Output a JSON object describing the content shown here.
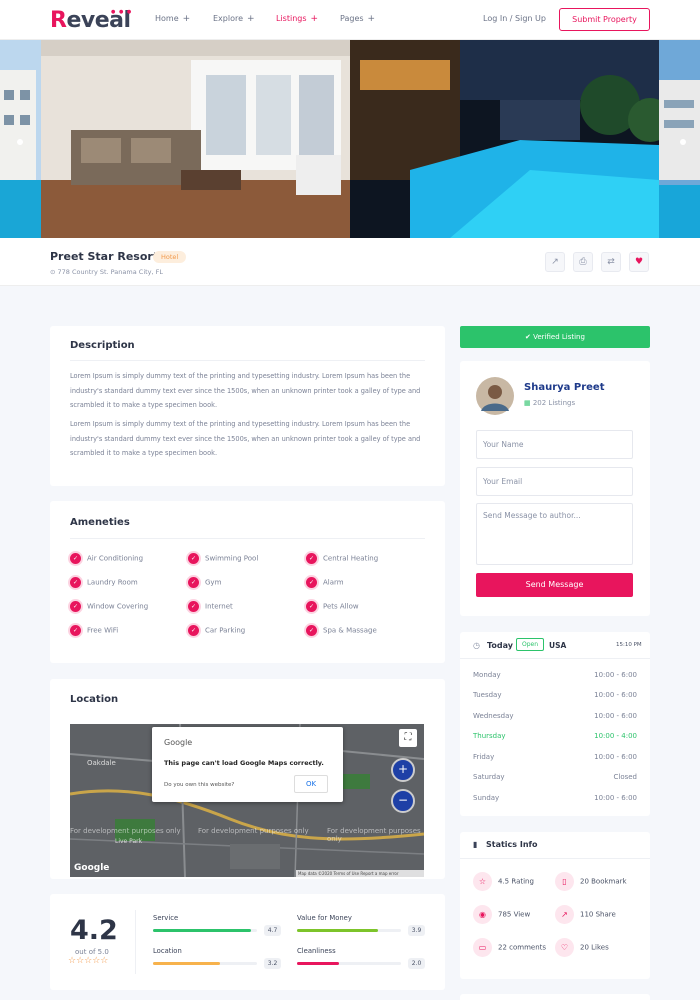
{
  "header": {
    "logo": "Reveal",
    "nav": [
      {
        "label": "Home",
        "plus": "+"
      },
      {
        "label": "Explore",
        "plus": "+"
      },
      {
        "label": "Listings",
        "plus": "+"
      },
      {
        "label": "Pages",
        "plus": "+"
      }
    ],
    "login": "Log In  /  Sign Up",
    "submit": "Submit Property"
  },
  "listing": {
    "title": "Preet Star Resort",
    "badge": "Hotel",
    "address": "778 Country St. Panama City, FL"
  },
  "description": {
    "title": "Description",
    "paragraphs": [
      "Lorem Ipsum is simply dummy text of the printing and typesetting industry. Lorem Ipsum has been the industry's standard dummy text ever since the 1500s, when an unknown printer took a galley of type and scrambled it to make a type specimen book.",
      "Lorem Ipsum is simply dummy text of the printing and typesetting industry. Lorem Ipsum has been the industry's standard dummy text ever since the 1500s, when an unknown printer took a galley of type and scrambled it to make a type specimen book."
    ]
  },
  "amenities": {
    "title": "Ameneties",
    "items": [
      "Air Conditioning",
      "Swimming Pool",
      "Central Heating",
      "Laundry Room",
      "Gym",
      "Alarm",
      "Window Covering",
      "Internet",
      "Pets Allow",
      "Free WiFi",
      "Car Parking",
      "Spa & Massage"
    ]
  },
  "location": {
    "title": "Location",
    "map": {
      "google": "Google",
      "error": "This page can't load Google Maps correctly.",
      "own": "Do you own this website?",
      "ok": "OK",
      "watermark": "For development purposes only",
      "footer": "Map data ©2020   Terms of Use   Report a map error",
      "places": [
        "Oakdale",
        "Live Park"
      ]
    }
  },
  "rating": {
    "score": "4.2",
    "out_of": "out of 5.0",
    "stars": "☆☆☆☆☆",
    "items": [
      {
        "label": "Service",
        "value": "4.7",
        "pct": 94,
        "color": "#2cc36b"
      },
      {
        "label": "Value for Money",
        "value": "3.9",
        "pct": 78,
        "color": "#7dc42a"
      },
      {
        "label": "Location",
        "value": "3.2",
        "pct": 64,
        "color": "#f7b24c"
      },
      {
        "label": "Cleanliness",
        "value": "2.0",
        "pct": 40,
        "color": "#e8155d"
      }
    ]
  },
  "sidebar": {
    "verified": "✔  Verified Listing",
    "agent": {
      "name": "Shaurya Preet",
      "listings": "202 Listings"
    },
    "form": {
      "name": "Your Name",
      "email": "Your Email",
      "message": "Send Message to author...",
      "send": "Send Message"
    },
    "hours": {
      "today": "Today",
      "status": "Open",
      "country": "USA",
      "time": "15:10 PM",
      "rows": [
        {
          "day": "Monday",
          "time": "10:00 - 6:00"
        },
        {
          "day": "Tuesday",
          "time": "10:00 - 6:00"
        },
        {
          "day": "Wednesday",
          "time": "10:00 - 6:00"
        },
        {
          "day": "Thursday",
          "time": "10:00 - 4:00"
        },
        {
          "day": "Friday",
          "time": "10:00 - 6:00"
        },
        {
          "day": "Saturday",
          "time": "Closed"
        },
        {
          "day": "Sunday",
          "time": "10:00 - 6:00"
        }
      ]
    },
    "stats": {
      "title": "Statics Info",
      "items": [
        "4.5 Rating",
        "20 Bookmark",
        "785 View",
        "110 Share",
        "22 comments",
        "20 Likes"
      ]
    }
  }
}
